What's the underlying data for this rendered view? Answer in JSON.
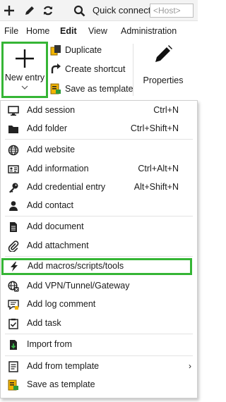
{
  "quick_access": {
    "quick_connect_label": "Quick connect",
    "host_placeholder": "<Host>",
    "icons": [
      "plus-icon",
      "pencil-icon",
      "refresh-icon",
      "search-icon"
    ]
  },
  "menu": {
    "tabs": [
      {
        "label": "File",
        "active": false
      },
      {
        "label": "Home",
        "active": false
      },
      {
        "label": "Edit",
        "active": true
      },
      {
        "label": "View",
        "active": false
      },
      {
        "label": "Administration",
        "active": false
      }
    ]
  },
  "ribbon": {
    "new_entry_label": "New entry",
    "duplicate_label": "Duplicate",
    "create_shortcut_label": "Create shortcut",
    "save_as_template_label": "Save as template",
    "properties_label": "Properties"
  },
  "dropdown": {
    "items": [
      {
        "label": "Add session",
        "shortcut": "Ctrl+N",
        "icon": "monitor-icon"
      },
      {
        "label": "Add folder",
        "shortcut": "Ctrl+Shift+N",
        "icon": "folder-icon"
      },
      {
        "label": "Add website",
        "shortcut": "",
        "icon": "globe-icon"
      },
      {
        "label": "Add information",
        "shortcut": "Ctrl+Alt+N",
        "icon": "id-card-icon"
      },
      {
        "label": "Add credential entry",
        "shortcut": "Alt+Shift+N",
        "icon": "key-icon"
      },
      {
        "label": "Add contact",
        "shortcut": "",
        "icon": "person-icon"
      },
      {
        "label": "Add document",
        "shortcut": "",
        "icon": "document-icon"
      },
      {
        "label": "Add attachment",
        "shortcut": "",
        "icon": "paperclip-icon"
      },
      {
        "label": "Add macros/scripts/tools",
        "shortcut": "",
        "icon": "lightning-icon"
      },
      {
        "label": "Add VPN/Tunnel/Gateway",
        "shortcut": "",
        "icon": "vpn-globe-icon"
      },
      {
        "label": "Add log comment",
        "shortcut": "",
        "icon": "comment-icon"
      },
      {
        "label": "Add task",
        "shortcut": "",
        "icon": "checkbox-icon"
      },
      {
        "label": "Import from",
        "shortcut": "",
        "icon": "import-icon"
      },
      {
        "label": "Add from template",
        "shortcut": "",
        "icon": "template-icon"
      },
      {
        "label": "Save as template",
        "shortcut": "",
        "icon": "save-template-icon"
      }
    ],
    "submenu_arrow": "›"
  },
  "colors": {
    "highlight": "#35b535",
    "icon_dark": "#2a2a2a",
    "qat_bg": "#f3f3f3"
  }
}
